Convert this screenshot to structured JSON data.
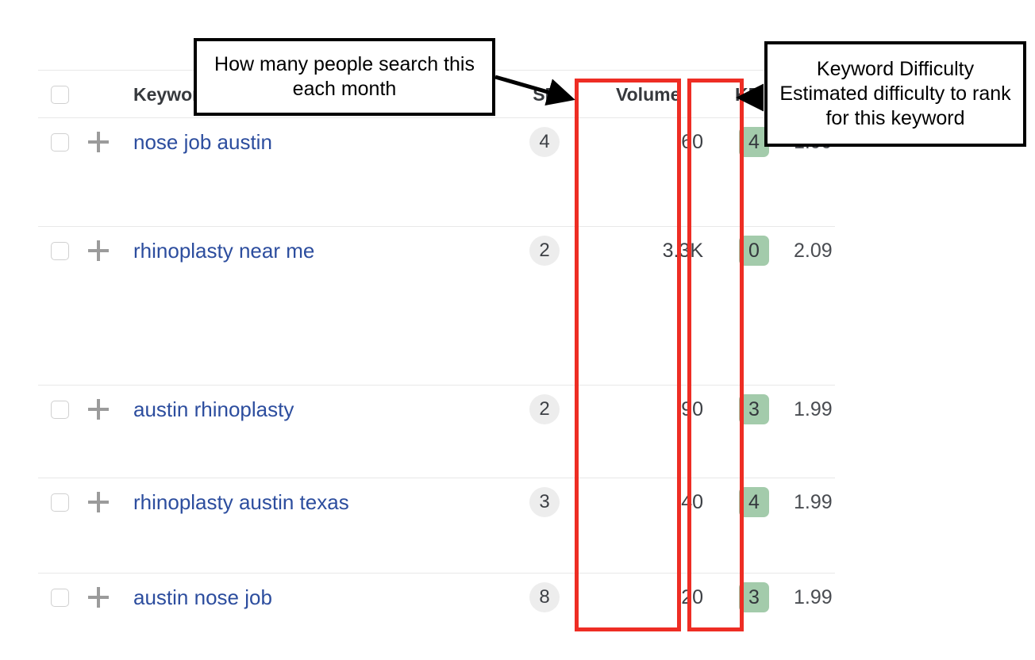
{
  "table": {
    "columns": {
      "select_label": "",
      "keyword": "Keyword",
      "sf": "SF",
      "volume": "Volume",
      "kd": "KD",
      "cpc": ""
    },
    "rows": [
      {
        "keyword": "nose job austin",
        "sf": "4",
        "volume": "60",
        "kd": "4",
        "cpc": "1.99"
      },
      {
        "keyword": "rhinoplasty near me",
        "sf": "2",
        "volume": "3.3K",
        "kd": "0",
        "cpc": "2.09"
      },
      {
        "keyword": "austin rhinoplasty",
        "sf": "2",
        "volume": "90",
        "kd": "3",
        "cpc": "1.99"
      },
      {
        "keyword": "rhinoplasty austin texas",
        "sf": "3",
        "volume": "40",
        "kd": "4",
        "cpc": "1.99"
      },
      {
        "keyword": "austin nose job",
        "sf": "8",
        "volume": "20",
        "kd": "3",
        "cpc": "1.99"
      }
    ]
  },
  "annotations": {
    "volume_callout": "How many people search this each month",
    "kd_callout": "Keyword Difficulty Estimated difficulty to rank for this keyword"
  },
  "colors": {
    "link": "#2c4d9e",
    "kd_badge": "#a3cbab",
    "sf_badge": "#ededed",
    "highlight": "#ee2d24",
    "row_divider": "#e8e8e8"
  }
}
